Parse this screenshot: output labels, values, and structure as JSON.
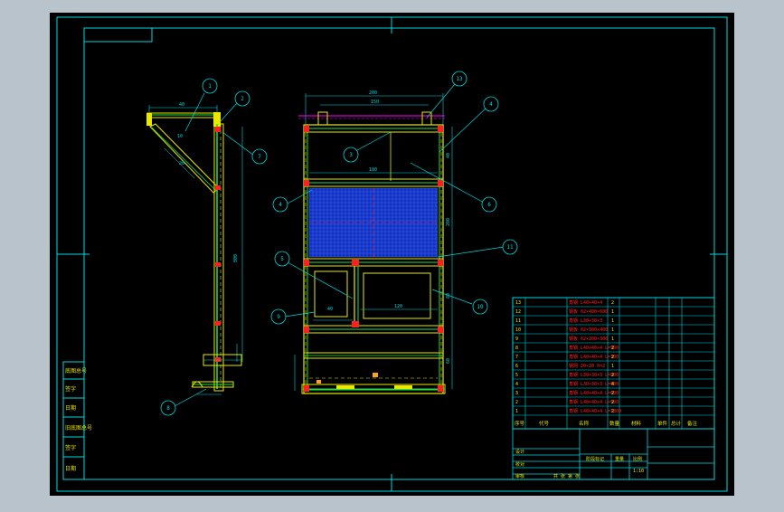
{
  "colors": {
    "app_bg": "#b9c3cc",
    "paper": "#000000",
    "frame": "#00d8e0",
    "steel": "#e8e800",
    "green": "#20e040",
    "red": "#ff2020",
    "mesh": "#1030c0",
    "magenta": "#ff00ff",
    "white": "#ffffff"
  },
  "balloons": {
    "side_1": "1",
    "side_2": "2",
    "side_7": "7",
    "side_8": "8",
    "front_13": "13",
    "front_4": "4",
    "front_3": "3",
    "front_4b": "4",
    "front_6": "6",
    "front_11": "11",
    "front_5": "5",
    "front_10": "10",
    "front_9": "9"
  },
  "dimensions": {
    "side_top": "40",
    "side_diag": "10",
    "side_slant": "20",
    "side_height": "800",
    "front_total_width": "200",
    "front_inner_width": "150",
    "front_mid_width": "180",
    "front_h1": "40",
    "front_h2": "200",
    "front_h3": "80",
    "front_h4": "60",
    "front_panel_left": "40",
    "front_panel_right": "120"
  },
  "left_strip": [
    "底图总号",
    "签字",
    "日期",
    "旧底图总号",
    "签字",
    "日期"
  ],
  "bom": {
    "header": [
      "序号",
      "代号",
      "名称",
      "数量",
      "材料",
      "单件",
      "总计",
      "备注"
    ],
    "rows": [
      {
        "no": "13",
        "name": "角钢 L40×40×4",
        "qty": "2"
      },
      {
        "no": "12",
        "name": "钢板 δ2×400×600",
        "qty": "1"
      },
      {
        "no": "11",
        "name": "角钢 L30×30×3",
        "qty": "1"
      },
      {
        "no": "10",
        "name": "钢板 δ2×300×400",
        "qty": "1"
      },
      {
        "no": "9",
        "name": "钢板 δ2×200×300",
        "qty": "1"
      },
      {
        "no": "8",
        "name": "角钢 L40×40×4 L=900",
        "qty": "2"
      },
      {
        "no": "7",
        "name": "角钢 L40×40×4 L=300",
        "qty": "2"
      },
      {
        "no": "6",
        "name": "钢网 20×20 δ=2",
        "qty": "1"
      },
      {
        "no": "5",
        "name": "角钢 L30×30×3 L=800",
        "qty": "2"
      },
      {
        "no": "4",
        "name": "角钢 L30×30×3 L=600",
        "qty": "4"
      },
      {
        "no": "3",
        "name": "角钢 L40×40×4 L=600",
        "qty": "2"
      },
      {
        "no": "2",
        "name": "角钢 L40×40×4 L=500",
        "qty": "2"
      },
      {
        "no": "1",
        "name": "角钢 L40×40×4 L=1800",
        "qty": "2"
      }
    ]
  },
  "title_block": {
    "design": "设计",
    "check": "校对",
    "approve": "审核",
    "stage_mark": "阶段标记",
    "weight": "重量",
    "scale": "比例",
    "scale_value": "1:10",
    "sheet": "共 张 第 张"
  }
}
